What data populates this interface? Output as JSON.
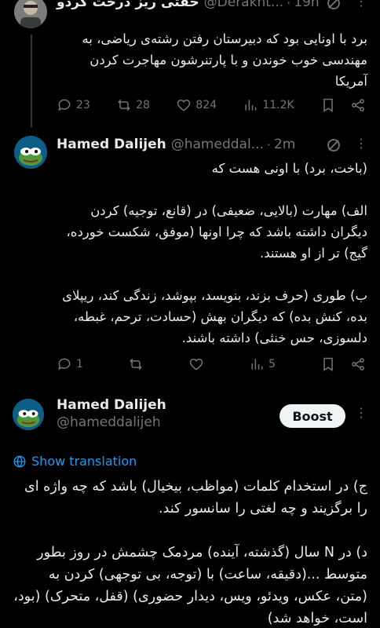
{
  "top_tweet": {
    "name": "حقتی ریز درخت کردو",
    "handle": "@Derakht...",
    "time": "19h",
    "body": "برد با اونایی بود که دبیرستان رفتن رشته‌ی ریاضی، به مهندسی خوب خوندن و با پارتنرشون مهاجرت کردن آمریکا",
    "replies": "23",
    "reposts": "28",
    "likes": "824",
    "views": "11.2K"
  },
  "tweet2": {
    "name": "Hamed Dalijeh",
    "handle": "@hameddal...",
    "time": "2m",
    "body": "(باخت، برد) با اونی هست که\n\nالف) مهارت (بالایی، ضعیفی) در (قانع، توجیه) کردن دیگران داشته باشد که چرا اونها (موفق، شکست خورده، گیج) تر از او هستند.\n\nب) طوری (حرف بزند، بنویسد، بپوشد، زندگی کند، ریپلای بده، کنش بده) که دیگران بهش (حسادت، ترحم، غبطه، دلسوزی، حس خنثی) داشته باشند.",
    "replies": "1",
    "views": "5"
  },
  "tweet3": {
    "name": "Hamed Dalijeh",
    "handle": "@hameddalijeh",
    "boost_label": "Boost",
    "show_translation": "Show translation",
    "body": "ج) در استخدام کلمات (مواظب، بیخیال) باشد که چه واژه ای را برگزیند و چه لغتی را سانسور کند.\n\nد) در N سال (گذشته، آینده) مردمک چشمش در روز بطور متوسط ...(دقیقه، ساعت) با (توجه، بی توجهی) کردن به (متن، عکس، ویدئو، ویس، دیدار حضوری) (قفل، متحرک) (بود، است، خواهد شد)"
  },
  "icons": {
    "reply": "reply-icon",
    "repost": "repost-icon",
    "like": "heart-icon",
    "views": "views-icon",
    "bookmark": "bookmark-icon",
    "share": "share-icon",
    "more": "more-icon",
    "grok": "grok-icon",
    "translate": "globe-icon"
  },
  "colors": {
    "background": "#000000",
    "text": "#e7e9ea",
    "muted": "#71767b",
    "link": "#1d9bf0",
    "boost_bg": "#eff3f4"
  }
}
